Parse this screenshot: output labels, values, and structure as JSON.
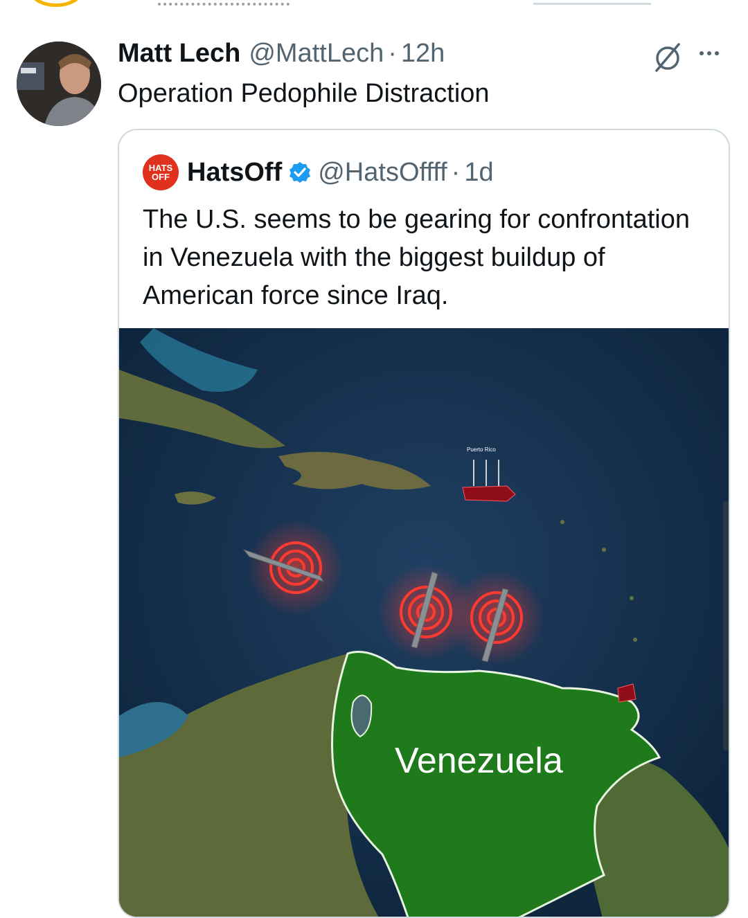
{
  "tweet": {
    "author_name": "Matt Lech",
    "author_handle": "@MattLech",
    "separator": "·",
    "timestamp": "12h",
    "text": "Operation Pedophile Distraction",
    "icons": [
      "grok-icon",
      "more-icon"
    ]
  },
  "quoted": {
    "logo_text_top": "HATS",
    "logo_text_bottom": "OFF",
    "author_name": "HatsOff",
    "author_handle": "@HatsOffff",
    "separator": "·",
    "timestamp": "1d",
    "verified": true,
    "text": "The U.S. seems to be gearing for confrontation in Venezuela with the biggest buildup of American force since Iraq.",
    "media": {
      "label_country": "Venezuela",
      "label_island": "Puerto Rico"
    }
  },
  "colors": {
    "accent_blue": "#1d9bf0",
    "secondary_text": "#536471",
    "brand_red": "#e0301e"
  }
}
